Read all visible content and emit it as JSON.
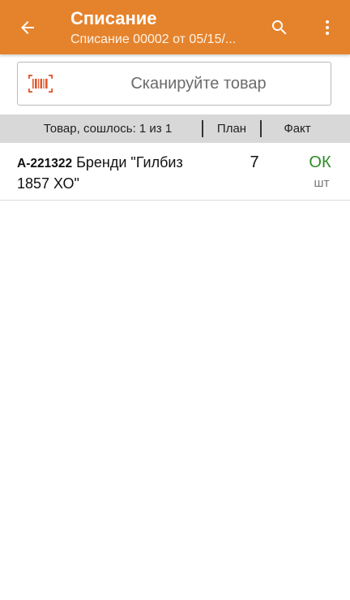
{
  "colors": {
    "appbar": "#e5832c",
    "header_row": "#d8d8d8",
    "status_ok": "#2e8b25",
    "barcode_accent": "#e2572b"
  },
  "appbar": {
    "title": "Списание",
    "subtitle": "Списание 00002 от 05/15/...",
    "back_icon": "arrow-back-icon",
    "search_icon": "search-icon",
    "menu_icon": "more-vert-icon"
  },
  "scan": {
    "icon": "barcode-icon",
    "placeholder": "Сканируйте товар"
  },
  "table": {
    "headers": {
      "item": "Товар, сошлось: 1 из 1",
      "plan": "План",
      "fact": "Факт"
    },
    "rows": [
      {
        "code": "А-221322",
        "name": "Бренди \"Гилбиз 1857 ХО\"",
        "plan": "7",
        "fact": "ОК",
        "unit": "шт"
      }
    ]
  }
}
